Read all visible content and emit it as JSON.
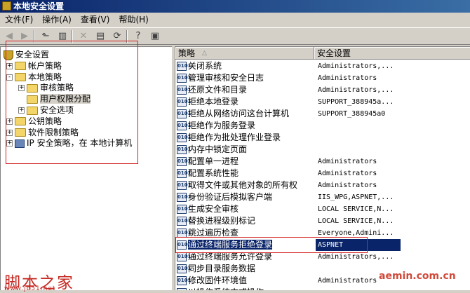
{
  "window": {
    "title": "本地安全设置"
  },
  "menu": [
    "文件(F)",
    "操作(A)",
    "查看(V)",
    "帮助(H)"
  ],
  "toolbar": [
    {
      "icon": "back-arrow-icon",
      "glyph": "◀",
      "disabled": true
    },
    {
      "icon": "forward-arrow-icon",
      "glyph": "▶",
      "disabled": true
    },
    {
      "icon": "up-folder-icon",
      "glyph": "⬑",
      "disabled": false
    },
    {
      "icon": "show-hide-tree-icon",
      "glyph": "▥",
      "disabled": false
    },
    {
      "icon": "delete-icon",
      "glyph": "✕",
      "disabled": true
    },
    {
      "icon": "properties-icon",
      "glyph": "▤",
      "disabled": false
    },
    {
      "icon": "refresh-icon",
      "glyph": "⟳",
      "disabled": false
    },
    {
      "icon": "help-icon",
      "glyph": "?",
      "disabled": false
    },
    {
      "icon": "show-hide-action-pane-icon",
      "glyph": "▣",
      "disabled": false
    }
  ],
  "tree": [
    {
      "label": "安全设置",
      "level": 0,
      "icon": "shield",
      "expander": "",
      "selected": false
    },
    {
      "label": "帐户策略",
      "level": 1,
      "icon": "folder",
      "expander": "+",
      "selected": false
    },
    {
      "label": "本地策略",
      "level": 1,
      "icon": "folder",
      "expander": "-",
      "selected": false
    },
    {
      "label": "审核策略",
      "level": 2,
      "icon": "folder",
      "expander": "+",
      "selected": false
    },
    {
      "label": "用户权限分配",
      "level": 2,
      "icon": "folder",
      "expander": "",
      "selected": true
    },
    {
      "label": "安全选项",
      "level": 2,
      "icon": "folder",
      "expander": "+",
      "selected": false
    },
    {
      "label": "公钥策略",
      "level": 1,
      "icon": "folder",
      "expander": "+",
      "selected": false
    },
    {
      "label": "软件限制策略",
      "level": 1,
      "icon": "folder",
      "expander": "+",
      "selected": false
    },
    {
      "label": "IP 安全策略，在 本地计算机",
      "level": 1,
      "icon": "computer",
      "expander": "+",
      "selected": false
    }
  ],
  "columns": {
    "policy": "策略",
    "setting": "安全设置"
  },
  "rows": [
    {
      "policy": "关闭系统",
      "setting": "Administrators,..."
    },
    {
      "policy": "管理审核和安全日志",
      "setting": "Administrators"
    },
    {
      "policy": "还原文件和目录",
      "setting": "Administrators,..."
    },
    {
      "policy": "拒绝本地登录",
      "setting": "SUPPORT_388945a..."
    },
    {
      "policy": "拒绝从网络访问这台计算机",
      "setting": "SUPPORT_388945a0"
    },
    {
      "policy": "拒绝作为服务登录",
      "setting": ""
    },
    {
      "policy": "拒绝作为批处理作业登录",
      "setting": ""
    },
    {
      "policy": "内存中锁定页面",
      "setting": ""
    },
    {
      "policy": "配置单一进程",
      "setting": "Administrators"
    },
    {
      "policy": "配置系统性能",
      "setting": "Administrators"
    },
    {
      "policy": "取得文件或其他对象的所有权",
      "setting": "Administrators"
    },
    {
      "policy": "身份验证后模拟客户端",
      "setting": "IIS_WPG,ASPNET,..."
    },
    {
      "policy": "生成安全审核",
      "setting": "LOCAL SERVICE,N..."
    },
    {
      "policy": "替换进程级别标记",
      "setting": "LOCAL SERVICE,N..."
    },
    {
      "policy": "跳过遍历检查",
      "setting": "Everyone,Admini..."
    },
    {
      "policy": "通过终端服务拒绝登录",
      "setting": "ASPNET"
    },
    {
      "policy": "通过终端服务允许登录",
      "setting": "Administrators,..."
    },
    {
      "policy": "同步目录服务数据",
      "setting": ""
    },
    {
      "policy": "修改固件环境值",
      "setting": "Administrators"
    },
    {
      "policy": "以操作系统方式操作",
      "setting": ""
    }
  ],
  "selected_row": 15,
  "watermarks": {
    "brand": "脚本之家",
    "url": "www.jb51.net",
    "site": "aemin.com.cn"
  },
  "accent_colors": {
    "selection": "#0a246a",
    "annotation": "#d21f1f"
  }
}
